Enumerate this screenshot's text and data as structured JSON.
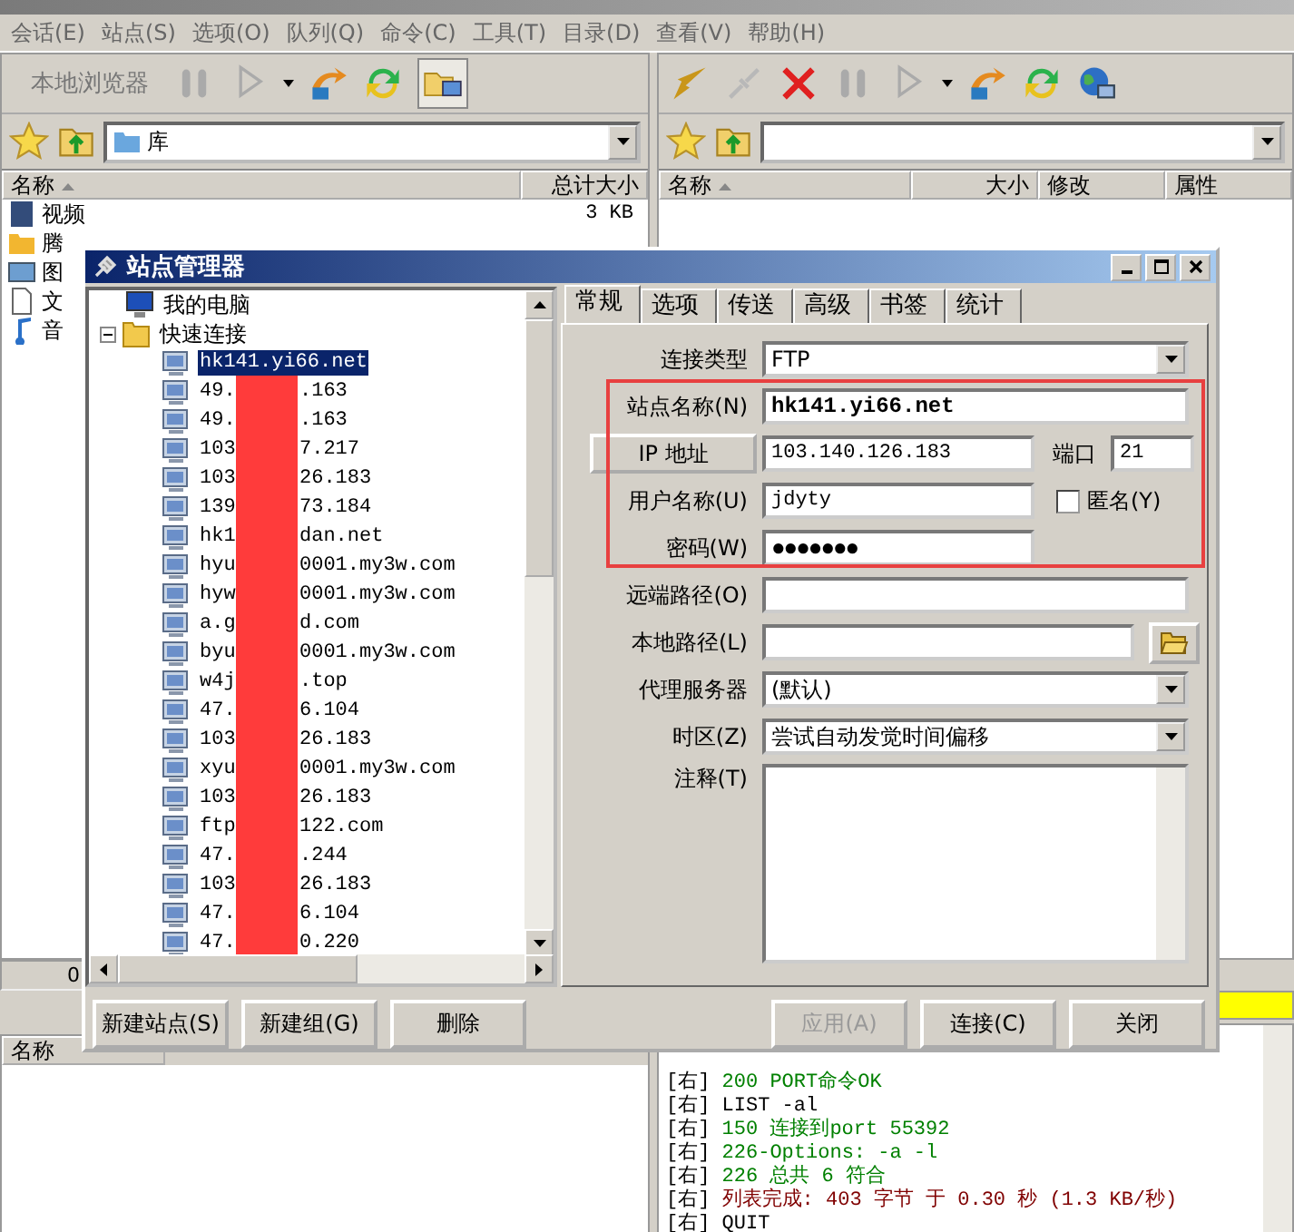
{
  "menu": [
    "会话(E)",
    "站点(S)",
    "选项(O)",
    "队列(Q)",
    "命令(C)",
    "工具(T)",
    "目录(D)",
    "查看(V)",
    "帮助(H)"
  ],
  "left_pane": {
    "toolbar_label": "本地浏览器",
    "path": "库",
    "columns": [
      "名称",
      "总计大小"
    ],
    "rows": [
      {
        "name": "视频",
        "size": "3 KB",
        "kind": "video"
      },
      {
        "name": "腾",
        "size": "",
        "kind": "folder"
      },
      {
        "name": "图",
        "size": "",
        "kind": "picture"
      },
      {
        "name": "文",
        "size": "",
        "kind": "document"
      },
      {
        "name": "音",
        "size": "",
        "kind": "music"
      }
    ],
    "status": "0"
  },
  "right_pane": {
    "columns": [
      "名称",
      "大小",
      "修改",
      "属性"
    ]
  },
  "queue": {
    "columns": [
      "名称"
    ]
  },
  "log": [
    {
      "tag": "[右]",
      "text": "200 PORT命令OK",
      "color": "#008000"
    },
    {
      "tag": "[右]",
      "text": "LIST -al",
      "color": "#000000"
    },
    {
      "tag": "[右]",
      "text": "150 连接到port 55392",
      "color": "#008000"
    },
    {
      "tag": "[右]",
      "text": "226-Options: -a -l",
      "color": "#008000"
    },
    {
      "tag": "[右]",
      "text": "226 总共 6 符合",
      "color": "#008000"
    },
    {
      "tag": "[右]",
      "text": "列表完成: 403 字节 于 0.30 秒 (1.3 KB/秒)",
      "color": "#800000"
    },
    {
      "tag": "[右]",
      "text": "QUIT",
      "color": "#000000"
    }
  ],
  "dialog": {
    "title": "站点管理器",
    "tree": [
      {
        "label": "我的电脑",
        "kind": "computer"
      },
      {
        "label": "快速连接",
        "kind": "folder",
        "expanded": true,
        "children": [
          {
            "kind": "full",
            "label": "hk141.yi66.net",
            "selected": true
          },
          {
            "kind": "masked",
            "prefix": "49.",
            "suffix": ".163",
            "selected": false
          },
          {
            "kind": "masked",
            "prefix": "49.",
            "suffix": ".163",
            "selected": false
          },
          {
            "kind": "masked",
            "prefix": "103",
            "suffix": "7.217",
            "selected": false
          },
          {
            "kind": "masked",
            "prefix": "103",
            "suffix": "26.183",
            "selected": false
          },
          {
            "kind": "masked",
            "prefix": "139",
            "suffix": "73.184",
            "selected": false
          },
          {
            "kind": "masked",
            "prefix": "hk1",
            "suffix": "dan.net",
            "selected": false
          },
          {
            "kind": "masked",
            "prefix": "hyu",
            "suffix": "0001.my3w.com",
            "selected": false
          },
          {
            "kind": "masked",
            "prefix": "hyw",
            "suffix": "0001.my3w.com",
            "selected": false
          },
          {
            "kind": "masked",
            "prefix": "a.g",
            "suffix": "d.com",
            "selected": false
          },
          {
            "kind": "masked",
            "prefix": "byu",
            "suffix": "0001.my3w.com",
            "selected": false
          },
          {
            "kind": "masked",
            "prefix": "w4j",
            "suffix": ".top",
            "selected": false
          },
          {
            "kind": "masked",
            "prefix": "47.",
            "suffix": "6.104",
            "selected": false
          },
          {
            "kind": "masked",
            "prefix": "103",
            "suffix": "26.183",
            "selected": false
          },
          {
            "kind": "masked",
            "prefix": "xyu",
            "suffix": "0001.my3w.com",
            "selected": false
          },
          {
            "kind": "masked",
            "prefix": "103",
            "suffix": "26.183",
            "selected": false
          },
          {
            "kind": "masked",
            "prefix": "ftp",
            "suffix": "122.com",
            "selected": false
          },
          {
            "kind": "masked",
            "prefix": "47.",
            "suffix": ".244",
            "selected": false
          },
          {
            "kind": "masked",
            "prefix": "103",
            "suffix": "26.183",
            "selected": false
          },
          {
            "kind": "masked",
            "prefix": "47.",
            "suffix": "6.104",
            "selected": false
          },
          {
            "kind": "masked",
            "prefix": "47.",
            "suffix": "0.220",
            "selected": false
          }
        ]
      }
    ],
    "tabs": [
      {
        "label": "常规",
        "selected": true
      },
      {
        "label": "选项",
        "selected": false
      },
      {
        "label": "传送",
        "selected": false
      },
      {
        "label": "高级",
        "selected": false
      },
      {
        "label": "书签",
        "selected": false
      },
      {
        "label": "统计",
        "selected": false
      }
    ],
    "connection_type": {
      "label": "连接类型",
      "value": "FTP"
    },
    "site_name": {
      "label": "站点名称(N)",
      "value": "hk141.yi66.net"
    },
    "ip": {
      "button": "IP 地址",
      "value": "103.140.126.183",
      "port_label": "端口",
      "port": "21"
    },
    "user": {
      "label": "用户名称(U)",
      "value": "jdyty",
      "anonymous_label": "匿名(Y)",
      "anonymous": false
    },
    "password": {
      "label": "密码(W)",
      "value": "●●●●●●●"
    },
    "remote_path": {
      "label": "远端路径(O)"
    },
    "local_path": {
      "label": "本地路径(L)"
    },
    "proxy": {
      "label": "代理服务器",
      "value": "(默认)"
    },
    "timezone": {
      "label": "时区(Z)",
      "value": "尝试自动发觉时间偏移"
    },
    "notes": {
      "label": "注释(T)"
    },
    "left_buttons": [
      "新建站点(S)",
      "新建组(G)",
      "删除"
    ],
    "right_buttons": [
      {
        "label": "应用(A)",
        "disabled": true
      },
      {
        "label": "连接(C)",
        "disabled": false
      },
      {
        "label": "关闭",
        "disabled": false
      }
    ]
  }
}
